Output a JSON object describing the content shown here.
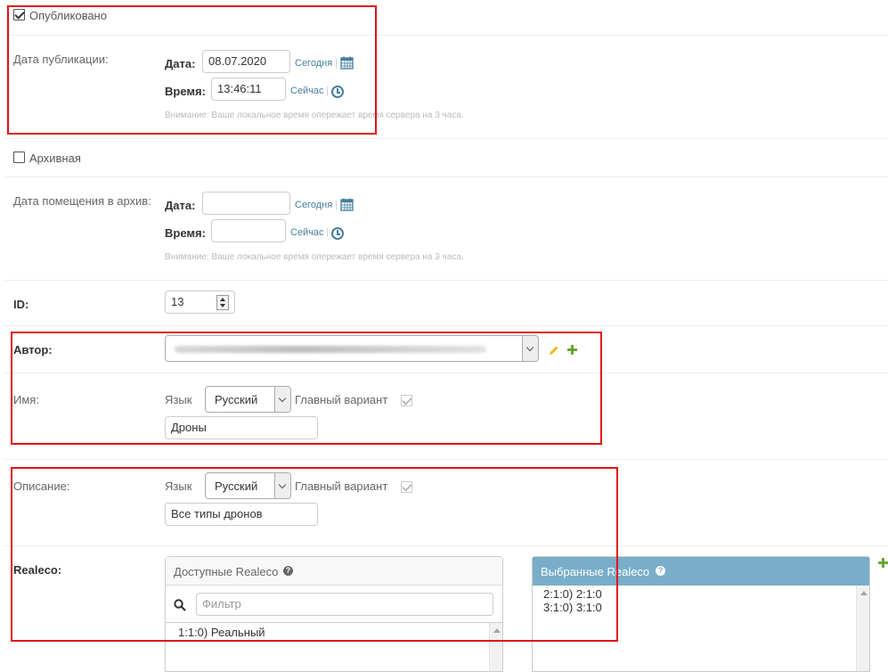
{
  "published": {
    "checkbox_label": "Опубликовано",
    "checked": true,
    "field_label": "Дата публикации:",
    "date_label": "Дата:",
    "date_value": "08.07.2020",
    "today_link": "Сегодня",
    "time_label": "Время:",
    "time_value": "13:46:11",
    "now_link": "Сейчас",
    "help_text": "Внимание: Ваше локальное время опережает время сервера на 3 часа."
  },
  "archive": {
    "checkbox_label": "Архивная",
    "checked": false,
    "field_label": "Дата помещения в архив:",
    "date_label": "Дата:",
    "date_value": "",
    "today_link": "Сегодня",
    "time_label": "Время:",
    "time_value": "",
    "now_link": "Сейчас",
    "help_text": "Внимание: Ваше локальное время опережает время сервера на 3 часа."
  },
  "id_field": {
    "label": "ID:",
    "value": "13"
  },
  "author": {
    "label": "Автор:"
  },
  "name": {
    "label": "Имя:",
    "lang_label": "Язык",
    "lang_value": "Русский",
    "main_variant_label": "Главный вариант",
    "main_variant_checked": true,
    "value": "Дроны"
  },
  "description": {
    "label": "Описание:",
    "lang_label": "Язык",
    "lang_value": "Русский",
    "main_variant_label": "Главный вариант",
    "main_variant_checked": true,
    "value": "Все типы дронов"
  },
  "realeco": {
    "label": "Realeco:",
    "available_title": "Доступные Realeco",
    "filter_placeholder": "Фильтр",
    "available_items": [
      "1:1:0) Реальный"
    ],
    "chosen_title": "Выбранные Realeco",
    "chosen_items": [
      "2:1:0) 2:1:0",
      "3:1:0) 3:1:0"
    ]
  },
  "colors": {
    "highlight_border": "#e0101a",
    "link": "#447e9b",
    "chosen_header": "#79aec8",
    "add_icon": "#5fa225",
    "edit_icon": "#efb80b"
  },
  "icons": {
    "calendar": "calendar-icon",
    "clock": "clock-icon",
    "edit": "pencil-icon",
    "add": "plus-icon",
    "help": "question-icon",
    "search": "search-icon"
  }
}
